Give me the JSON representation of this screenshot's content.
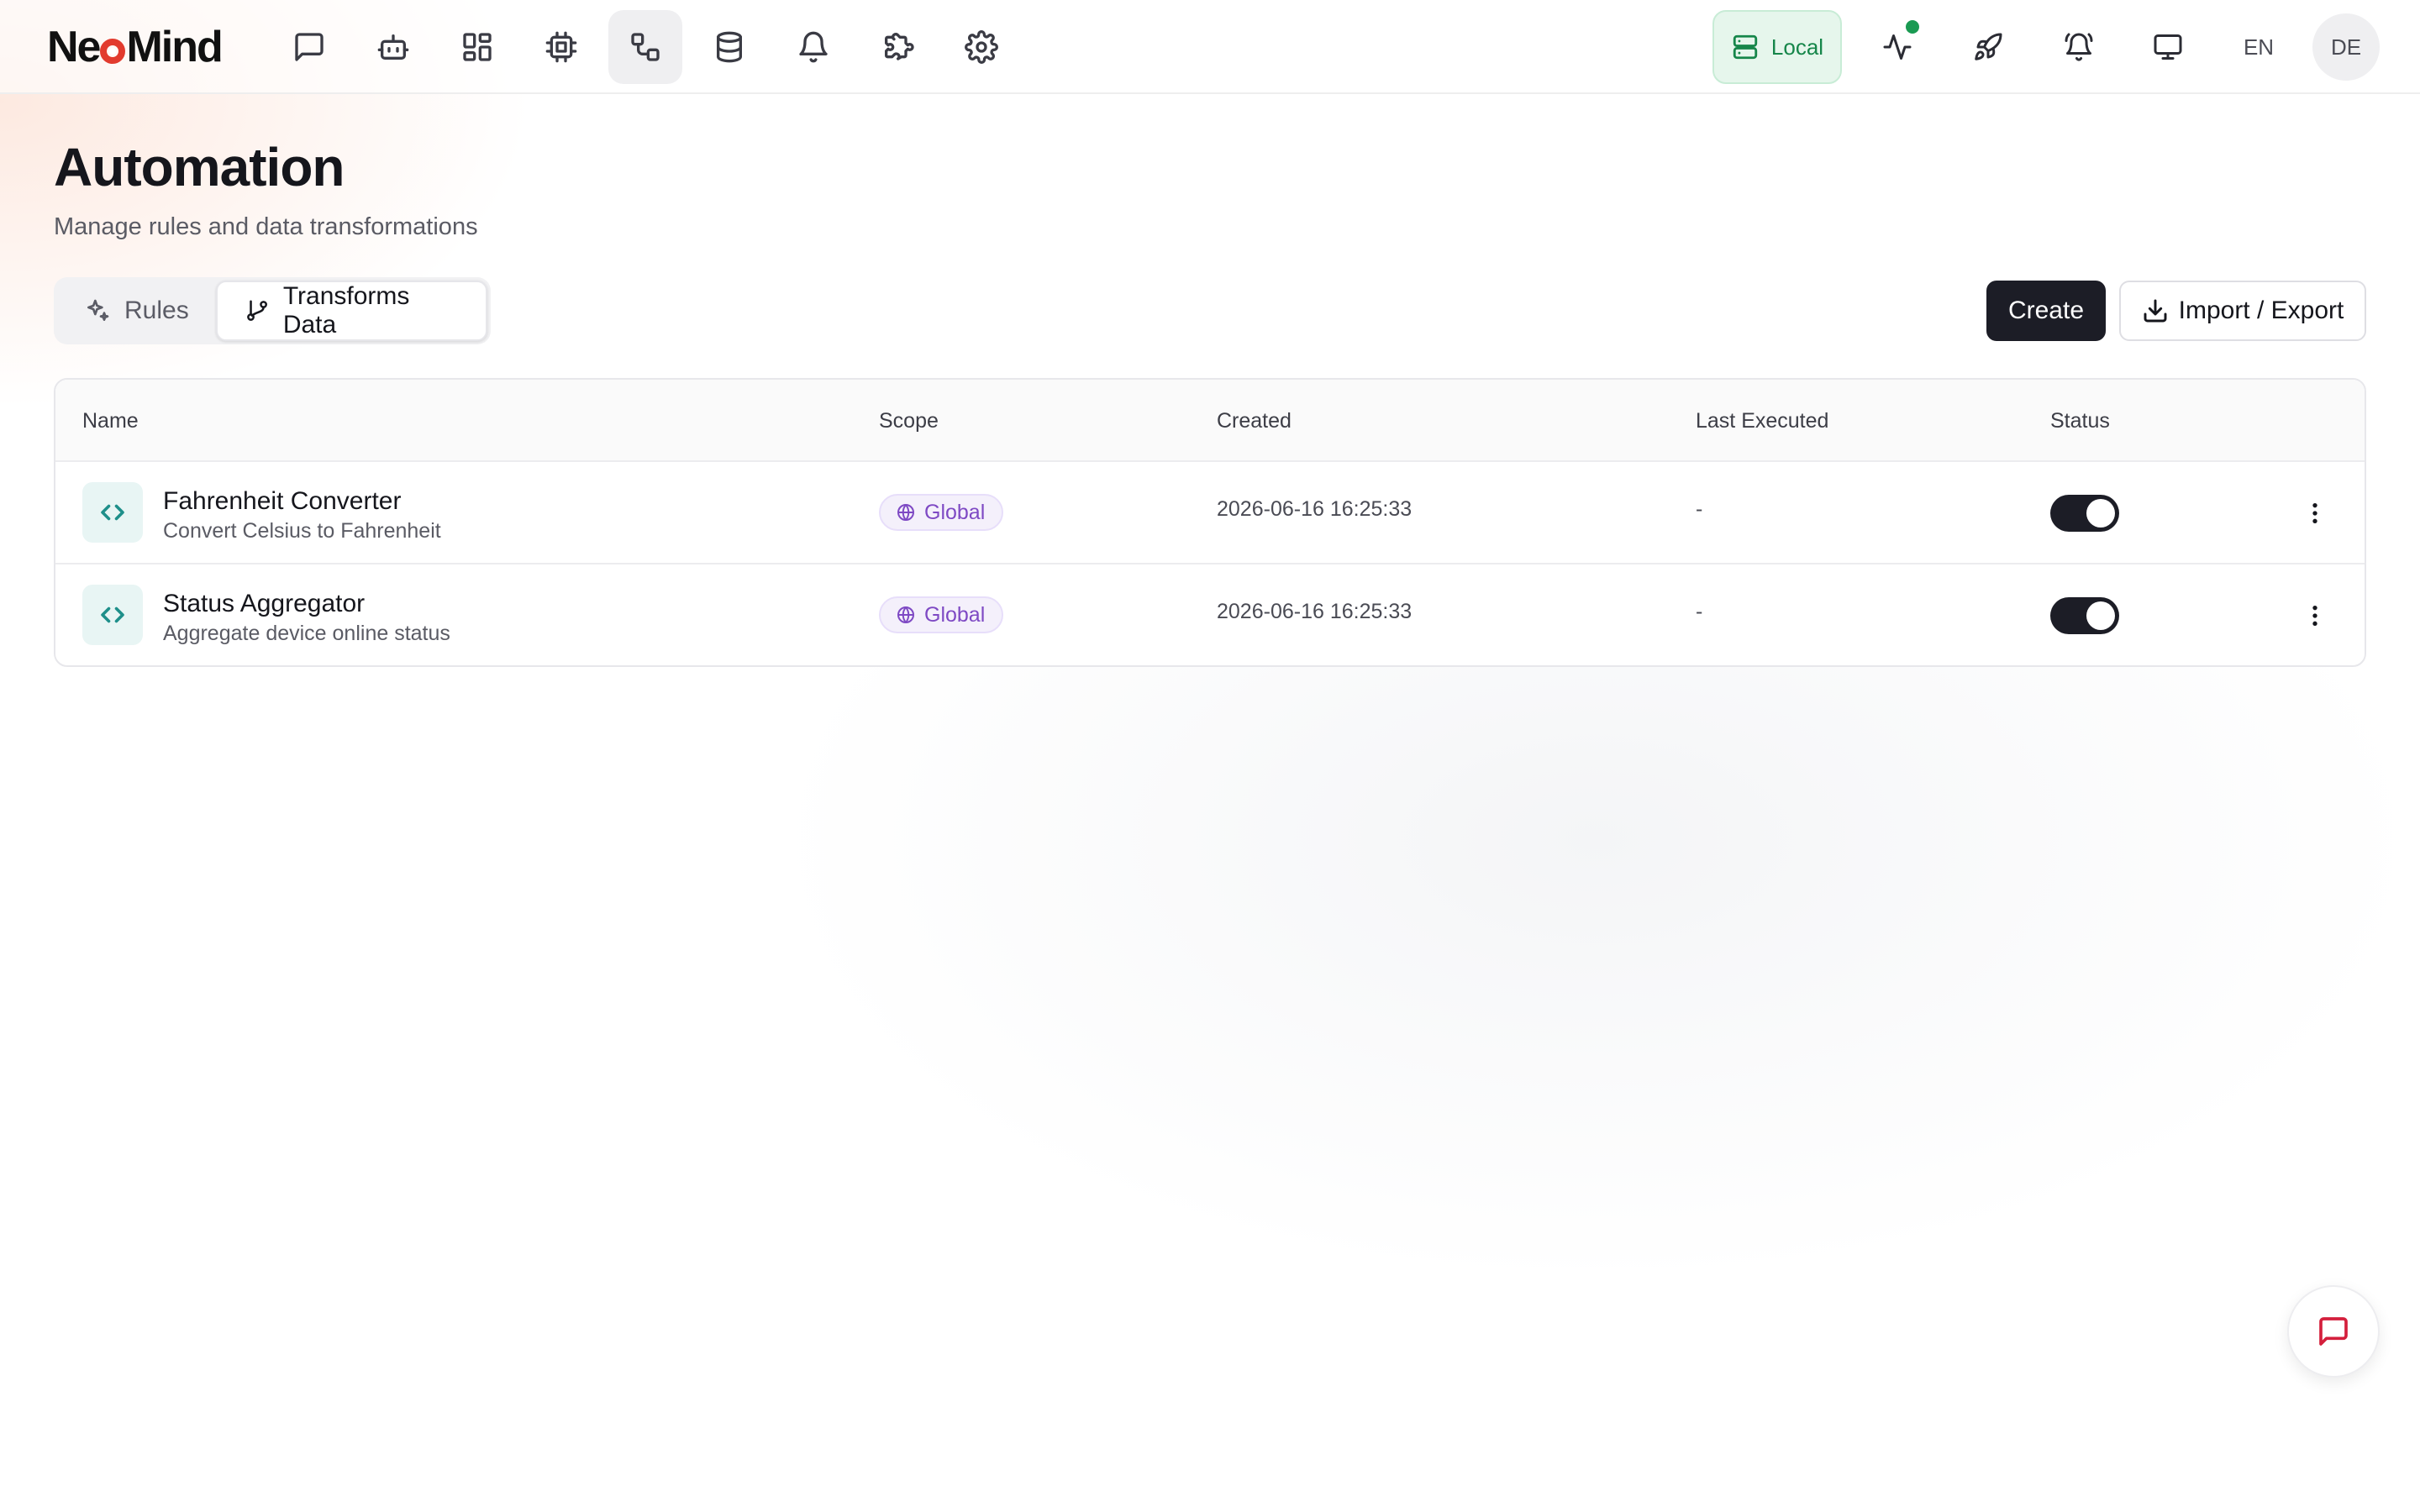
{
  "app": {
    "logo_text_before": "Ne",
    "logo_text_after": "Mind",
    "brand_color": "#e23b2e"
  },
  "nav": {
    "icons": [
      {
        "name": "chat-icon",
        "active": false
      },
      {
        "name": "bot-icon",
        "active": false
      },
      {
        "name": "dashboard-icon",
        "active": false
      },
      {
        "name": "chip-icon",
        "active": false
      },
      {
        "name": "automation-icon",
        "active": true
      },
      {
        "name": "database-icon",
        "active": false
      },
      {
        "name": "bell-icon",
        "active": false
      },
      {
        "name": "puzzle-icon",
        "active": false
      },
      {
        "name": "gear-icon",
        "active": false
      }
    ]
  },
  "topbar_right": {
    "connection_label": "Local",
    "connection_color": "#16864a",
    "activity_status": "online",
    "lang_en": "EN",
    "lang_de": "DE"
  },
  "page": {
    "title": "Automation",
    "subtitle": "Manage rules and data transformations"
  },
  "tabs": {
    "rules_label": "Rules",
    "transforms_label": "Transforms Data",
    "active": "transforms"
  },
  "actions": {
    "create_label": "Create",
    "import_export_label": "Import / Export"
  },
  "table": {
    "columns": {
      "name": "Name",
      "scope": "Scope",
      "created": "Created",
      "last_executed": "Last Executed",
      "status": "Status"
    },
    "rows": [
      {
        "title": "Fahrenheit Converter",
        "description": "Convert Celsius to Fahrenheit",
        "scope": "Global",
        "created": "2026-06-16 16:25:33",
        "last_executed": "-",
        "enabled": true
      },
      {
        "title": "Status Aggregator",
        "description": "Aggregate device online status",
        "scope": "Global",
        "created": "2026-06-16 16:25:33",
        "last_executed": "-",
        "enabled": true
      }
    ]
  },
  "colors": {
    "scope_badge": "#7e49c4",
    "toggle_on": "#1c1d26",
    "chat_fab": "#d41f3c"
  }
}
